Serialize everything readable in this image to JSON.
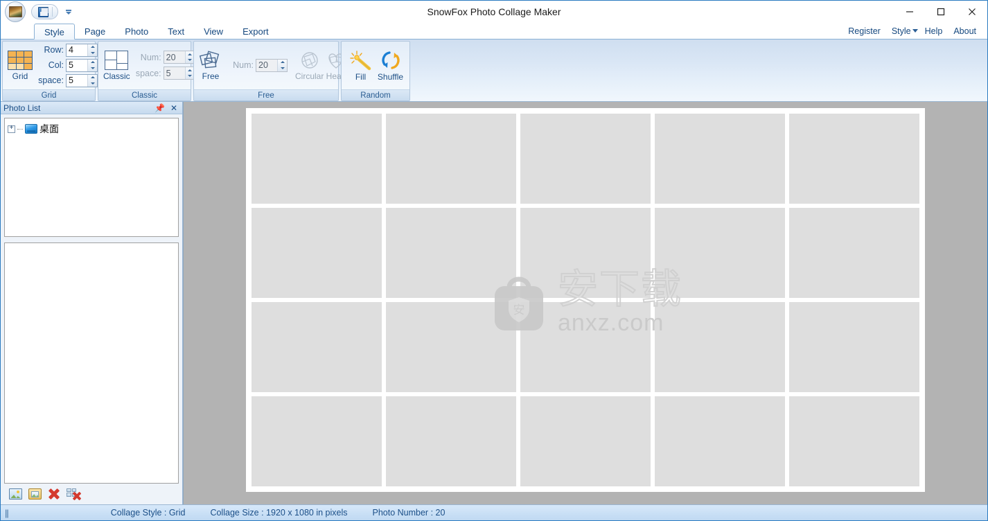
{
  "window": {
    "title": "SnowFox Photo Collage Maker",
    "minimize_label": "Minimize",
    "maximize_label": "Maximize",
    "close_label": "Close"
  },
  "quick_access": {
    "app_logo": "app-logo",
    "save_label": "Save",
    "customize_label": "Customize Quick Access Toolbar"
  },
  "tabs": [
    {
      "label": "Style",
      "active": true
    },
    {
      "label": "Page",
      "active": false
    },
    {
      "label": "Photo",
      "active": false
    },
    {
      "label": "Text",
      "active": false
    },
    {
      "label": "View",
      "active": false
    },
    {
      "label": "Export",
      "active": false
    }
  ],
  "topmenu": [
    {
      "label": "Register"
    },
    {
      "label": "Style",
      "has_caret": true
    },
    {
      "label": "Help"
    },
    {
      "label": "About"
    }
  ],
  "ribbon": {
    "groups": [
      {
        "name": "Grid",
        "footer": "Grid",
        "button": {
          "label": "Grid",
          "icon": "grid-icon",
          "enabled": true
        },
        "fields": [
          {
            "label": "Row:",
            "value": "4",
            "enabled": true
          },
          {
            "label": "Col:",
            "value": "5",
            "enabled": true
          },
          {
            "label": "space:",
            "value": "5",
            "enabled": true
          }
        ]
      },
      {
        "name": "Classic",
        "footer": "Classic",
        "button": {
          "label": "Classic",
          "icon": "classic-icon",
          "enabled": true
        },
        "fields": [
          {
            "label": "Num:",
            "value": "20",
            "enabled": false
          },
          {
            "label": "space:",
            "value": "5",
            "enabled": false
          }
        ]
      },
      {
        "name": "Free",
        "footer": "Free",
        "button": {
          "label": "Free",
          "icon": "free-icon",
          "enabled": true
        },
        "fields": [
          {
            "label": "Num:",
            "value": "20",
            "enabled": false
          }
        ],
        "extra_buttons": [
          {
            "label": "Circular",
            "icon": "circular-icon",
            "enabled": false
          },
          {
            "label": "Heart",
            "icon": "heart-icon",
            "enabled": false
          }
        ]
      },
      {
        "name": "Random",
        "footer": "Random",
        "extra_buttons": [
          {
            "label": "Fill",
            "icon": "magic-wand-icon",
            "enabled": true
          },
          {
            "label": "Shuffle",
            "icon": "shuffle-icon",
            "enabled": true
          }
        ]
      }
    ]
  },
  "sidebar": {
    "caption": "Photo List",
    "pin_label": "Pin",
    "close_label": "Close",
    "tree": [
      {
        "label": "桌面",
        "expander": "+",
        "icon": "desktop-icon"
      }
    ],
    "toolbar": [
      {
        "label": "Add Photo",
        "icon": "add-photo-icon"
      },
      {
        "label": "Add Folder",
        "icon": "add-folder-icon"
      },
      {
        "label": "Remove",
        "icon": "remove-icon"
      },
      {
        "label": "Remove All",
        "icon": "remove-all-icon"
      }
    ]
  },
  "canvas": {
    "rows": 4,
    "cols": 5,
    "cell_color": "#dedede",
    "sheet_color": "#ffffff",
    "background_color": "#b3b3b3",
    "watermark": {
      "cn": "安下载",
      "en": "anxz.com",
      "badge_char": "安"
    }
  },
  "statusbar": {
    "grip": "||",
    "items": [
      "Collage Style : Grid",
      "Collage Size : 1920 x 1080  in pixels",
      "Photo Number : 20"
    ]
  },
  "colors": {
    "accent": "#1d4f86",
    "ribbon_top": "#cfdef0",
    "title_border": "#2a7ac0"
  }
}
